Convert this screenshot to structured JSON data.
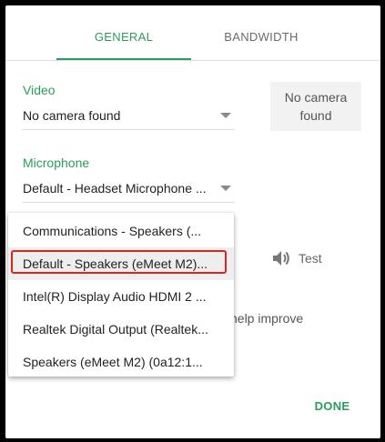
{
  "tabs": {
    "general": "GENERAL",
    "bandwidth": "BANDWIDTH"
  },
  "video": {
    "label": "Video",
    "selected": "No camera found",
    "preview_text": "No camera found"
  },
  "microphone": {
    "label": "Microphone",
    "selected": "Default - Headset Microphone ..."
  },
  "speakers": {
    "test_label": "Test",
    "options": [
      "Communications - Speakers (...",
      "Default - Speakers (eMeet M2)...",
      "Intel(R) Display Audio HDMI 2 ...",
      "Realtek Digital Output (Realtek...",
      "Speakers (eMeet M2) (0a12:1..."
    ],
    "selected_index": 1
  },
  "help_text": "help improve",
  "done_label": "DONE",
  "colors": {
    "accent": "#2a9d5c",
    "highlight": "#d7261e"
  }
}
